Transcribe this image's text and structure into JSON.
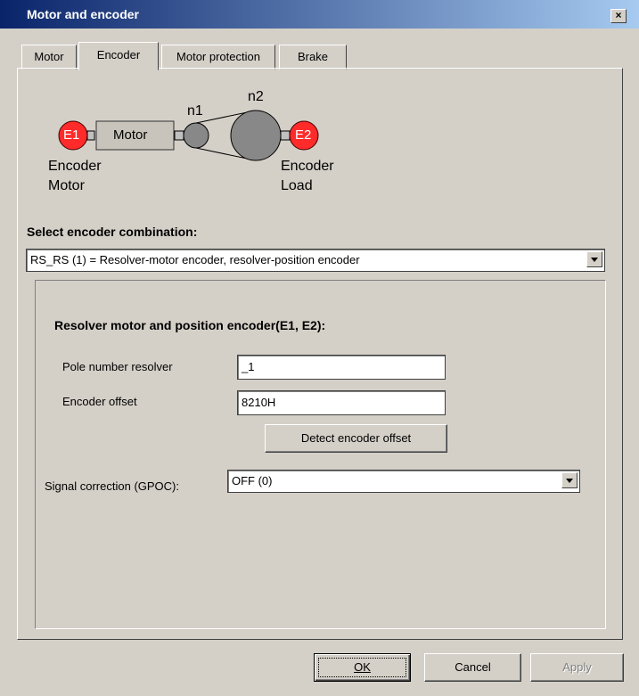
{
  "window": {
    "title": "Motor and encoder",
    "close_glyph": "×"
  },
  "tabs": [
    {
      "label": "Motor",
      "active": false
    },
    {
      "label": "Encoder",
      "active": true
    },
    {
      "label": "Motor protection",
      "active": false
    },
    {
      "label": "Brake",
      "active": false
    }
  ],
  "diagram": {
    "e1": "E1",
    "e2": "E2",
    "motor": "Motor",
    "n1": "n1",
    "n2": "n2",
    "encoder_motor_line1": "Encoder",
    "encoder_motor_line2": "Motor",
    "encoder_load_line1": "Encoder",
    "encoder_load_line2": "Load",
    "colors": {
      "encoder_red": "#ff0000",
      "motor_box": "#c0c0c0",
      "pulley": "#808080"
    }
  },
  "encoder_combination": {
    "label": "Select encoder combination:",
    "value": "RS_RS (1) = Resolver-motor encoder, resolver-position encoder"
  },
  "resolver": {
    "title": "Resolver motor and position encoder(E1, E2):",
    "pole_label": "Pole number resolver",
    "pole_value": "_1",
    "offset_label": "Encoder offset",
    "offset_value": "8210H",
    "detect_button": "Detect encoder offset",
    "signal_label": "Signal correction (GPOC):",
    "signal_value": "OFF (0)"
  },
  "buttons": {
    "ok": "OK",
    "cancel": "Cancel",
    "apply": "Apply"
  }
}
